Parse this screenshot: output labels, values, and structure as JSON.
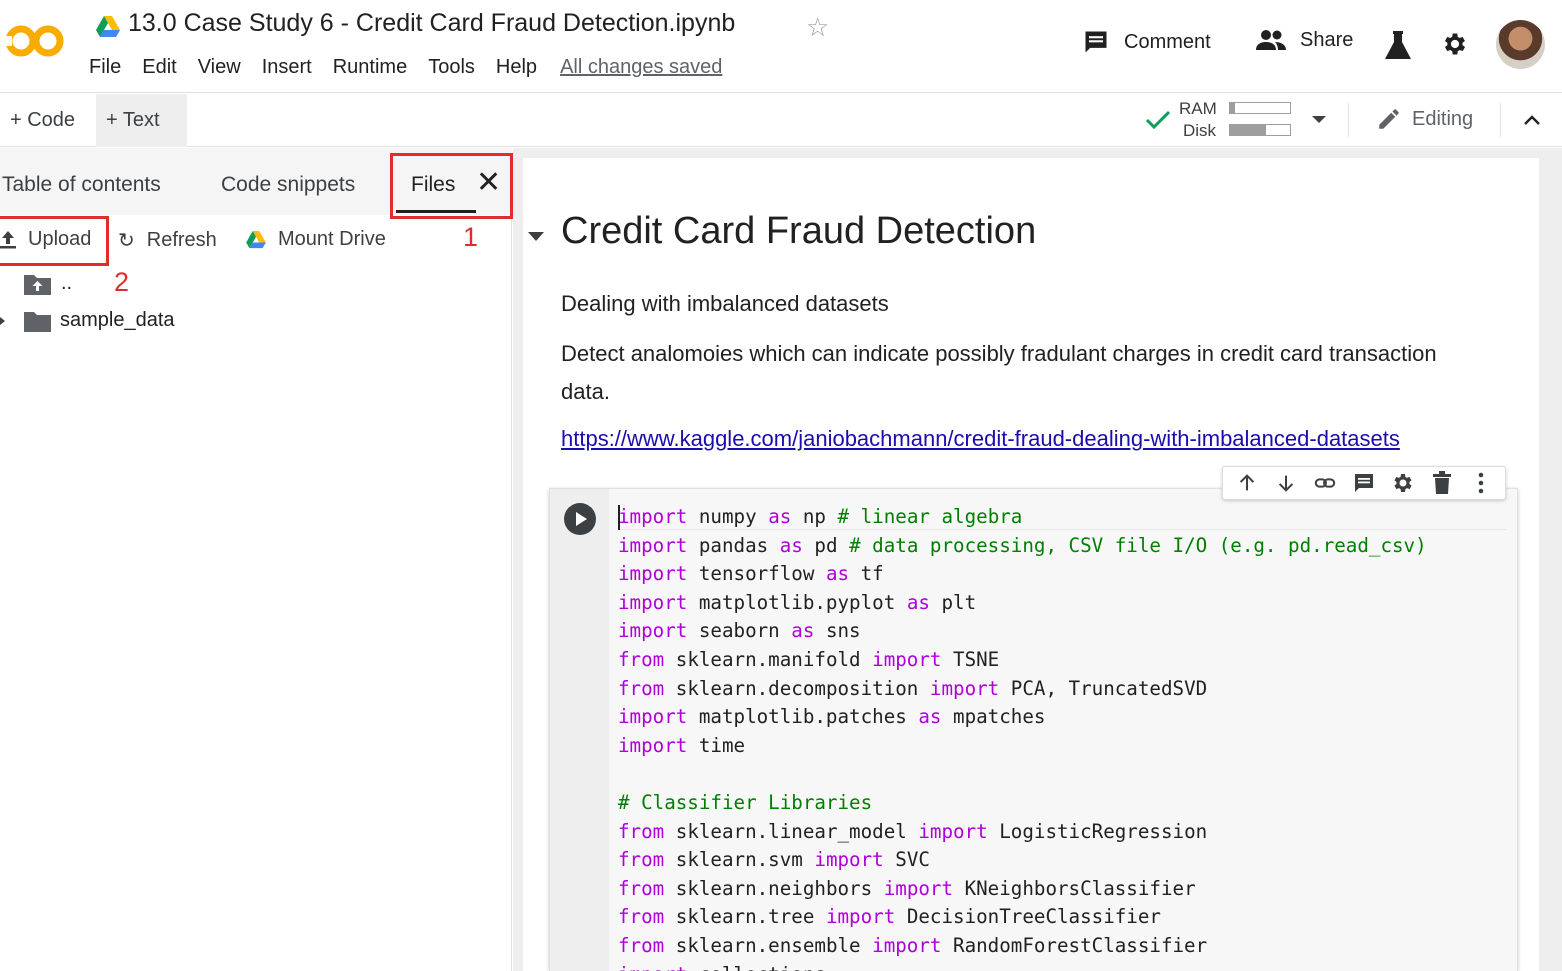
{
  "header": {
    "notebook_title": "13.0 Case Study 6 - Credit Card Fraud Detection.ipynb",
    "menu": [
      "File",
      "Edit",
      "View",
      "Insert",
      "Runtime",
      "Tools",
      "Help"
    ],
    "save_status": "All changes saved",
    "comment_label": "Comment",
    "share_label": "Share"
  },
  "toolbar": {
    "code_label": "+ Code",
    "text_label": "+ Text",
    "ram_label": "RAM",
    "disk_label": "Disk",
    "ram_usage": 0.08,
    "disk_usage": 0.6,
    "editing_label": "Editing"
  },
  "sidebar": {
    "tabs": [
      "Table of contents",
      "Code snippets",
      "Files"
    ],
    "active_tab": "Files",
    "annotation_1": "1",
    "annotation_2": "2",
    "actions": {
      "upload": "Upload",
      "refresh": "Refresh",
      "mount": "Mount Drive"
    },
    "files": [
      {
        "name": "..",
        "type": "parent-folder"
      },
      {
        "name": "sample_data",
        "type": "folder"
      }
    ]
  },
  "notebook": {
    "heading": "Credit Card Fraud Detection",
    "paragraph1": "Dealing with imbalanced datasets",
    "paragraph2": "Detect analomoies which can indicate possibly fradulant charges in credit card transaction data.",
    "link": "https://www.kaggle.com/janiobachmann/credit-fraud-dealing-with-imbalanced-datasets",
    "code_lines": [
      [
        [
          "kw",
          "import"
        ],
        [
          "t",
          " numpy "
        ],
        [
          "kw",
          "as"
        ],
        [
          "t",
          " np "
        ],
        [
          "cm",
          "# linear algebra"
        ]
      ],
      [
        [
          "kw",
          "import"
        ],
        [
          "t",
          " pandas "
        ],
        [
          "kw",
          "as"
        ],
        [
          "t",
          " pd "
        ],
        [
          "cm",
          "# data processing, CSV file I/O (e.g. pd.read_csv)"
        ]
      ],
      [
        [
          "kw",
          "import"
        ],
        [
          "t",
          " tensorflow "
        ],
        [
          "kw",
          "as"
        ],
        [
          "t",
          " tf"
        ]
      ],
      [
        [
          "kw",
          "import"
        ],
        [
          "t",
          " matplotlib.pyplot "
        ],
        [
          "kw",
          "as"
        ],
        [
          "t",
          " plt"
        ]
      ],
      [
        [
          "kw",
          "import"
        ],
        [
          "t",
          " seaborn "
        ],
        [
          "kw",
          "as"
        ],
        [
          "t",
          " sns"
        ]
      ],
      [
        [
          "kw",
          "from"
        ],
        [
          "t",
          " sklearn.manifold "
        ],
        [
          "kw",
          "import"
        ],
        [
          "t",
          " TSNE"
        ]
      ],
      [
        [
          "kw",
          "from"
        ],
        [
          "t",
          " sklearn.decomposition "
        ],
        [
          "kw",
          "import"
        ],
        [
          "t",
          " PCA, TruncatedSVD"
        ]
      ],
      [
        [
          "kw",
          "import"
        ],
        [
          "t",
          " matplotlib.patches "
        ],
        [
          "kw",
          "as"
        ],
        [
          "t",
          " mpatches"
        ]
      ],
      [
        [
          "kw",
          "import"
        ],
        [
          "t",
          " time"
        ]
      ],
      [
        [
          "t",
          ""
        ]
      ],
      [
        [
          "cm",
          "# Classifier Libraries"
        ]
      ],
      [
        [
          "kw",
          "from"
        ],
        [
          "t",
          " sklearn.linear_model "
        ],
        [
          "kw",
          "import"
        ],
        [
          "t",
          " LogisticRegression"
        ]
      ],
      [
        [
          "kw",
          "from"
        ],
        [
          "t",
          " sklearn.svm "
        ],
        [
          "kw",
          "import"
        ],
        [
          "t",
          " SVC"
        ]
      ],
      [
        [
          "kw",
          "from"
        ],
        [
          "t",
          " sklearn.neighbors "
        ],
        [
          "kw",
          "import"
        ],
        [
          "t",
          " KNeighborsClassifier"
        ]
      ],
      [
        [
          "kw",
          "from"
        ],
        [
          "t",
          " sklearn.tree "
        ],
        [
          "kw",
          "import"
        ],
        [
          "t",
          " DecisionTreeClassifier"
        ]
      ],
      [
        [
          "kw",
          "from"
        ],
        [
          "t",
          " sklearn.ensemble "
        ],
        [
          "kw",
          "import"
        ],
        [
          "t",
          " RandomForestClassifier"
        ]
      ],
      [
        [
          "kw",
          "import"
        ],
        [
          "t",
          " collections"
        ]
      ]
    ]
  },
  "colors": {
    "keyword": "#af00db",
    "comment": "#008000",
    "annotation_red": "#e02c2c",
    "link": "#1a0dab",
    "logo_orange": "#f9ab00"
  }
}
